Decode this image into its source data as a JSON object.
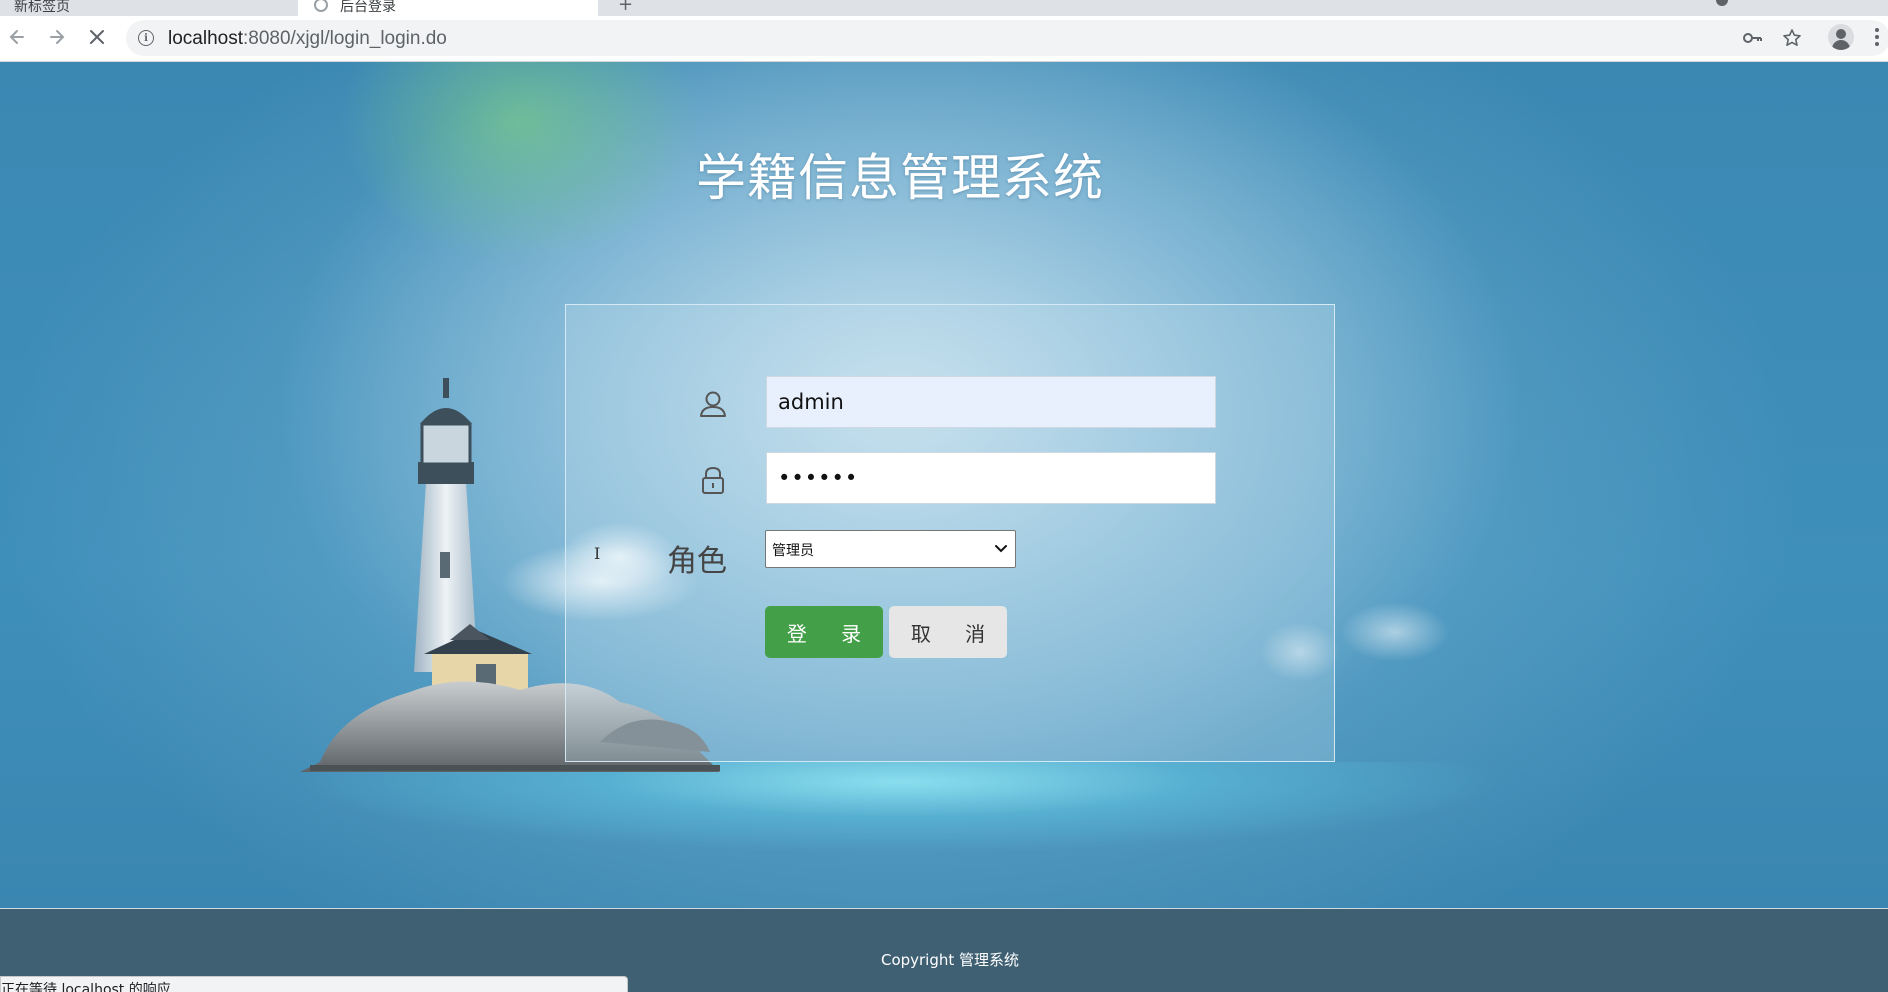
{
  "browser": {
    "tabs": [
      {
        "label": "新标签页",
        "active": false
      },
      {
        "label": "后台登录",
        "active": true
      }
    ],
    "url_host": "localhost",
    "url_path": ":8080/xjgl/login_login.do",
    "status_text": "正在等待 localhost 的响应..."
  },
  "page": {
    "title": "学籍信息管理系统",
    "login": {
      "username_value": "admin",
      "password_value": "••••••",
      "role_label": "角色",
      "role_selected": "管理员",
      "login_button": "登 录",
      "cancel_button": "取 消"
    },
    "footer": {
      "copyright": "Copyright 管理系统"
    }
  },
  "colors": {
    "login_button": "#44a048",
    "cancel_button": "#e6e6e6",
    "username_bg": "#e8f0fe",
    "footer_bg": "#3f6073"
  },
  "icons": [
    "back-icon",
    "forward-icon",
    "stop-icon",
    "info-icon",
    "key-icon",
    "star-icon",
    "profile-icon",
    "menu-icon",
    "user-icon",
    "lock-icon",
    "chevron-down-icon",
    "lighthouse-illustration"
  ]
}
